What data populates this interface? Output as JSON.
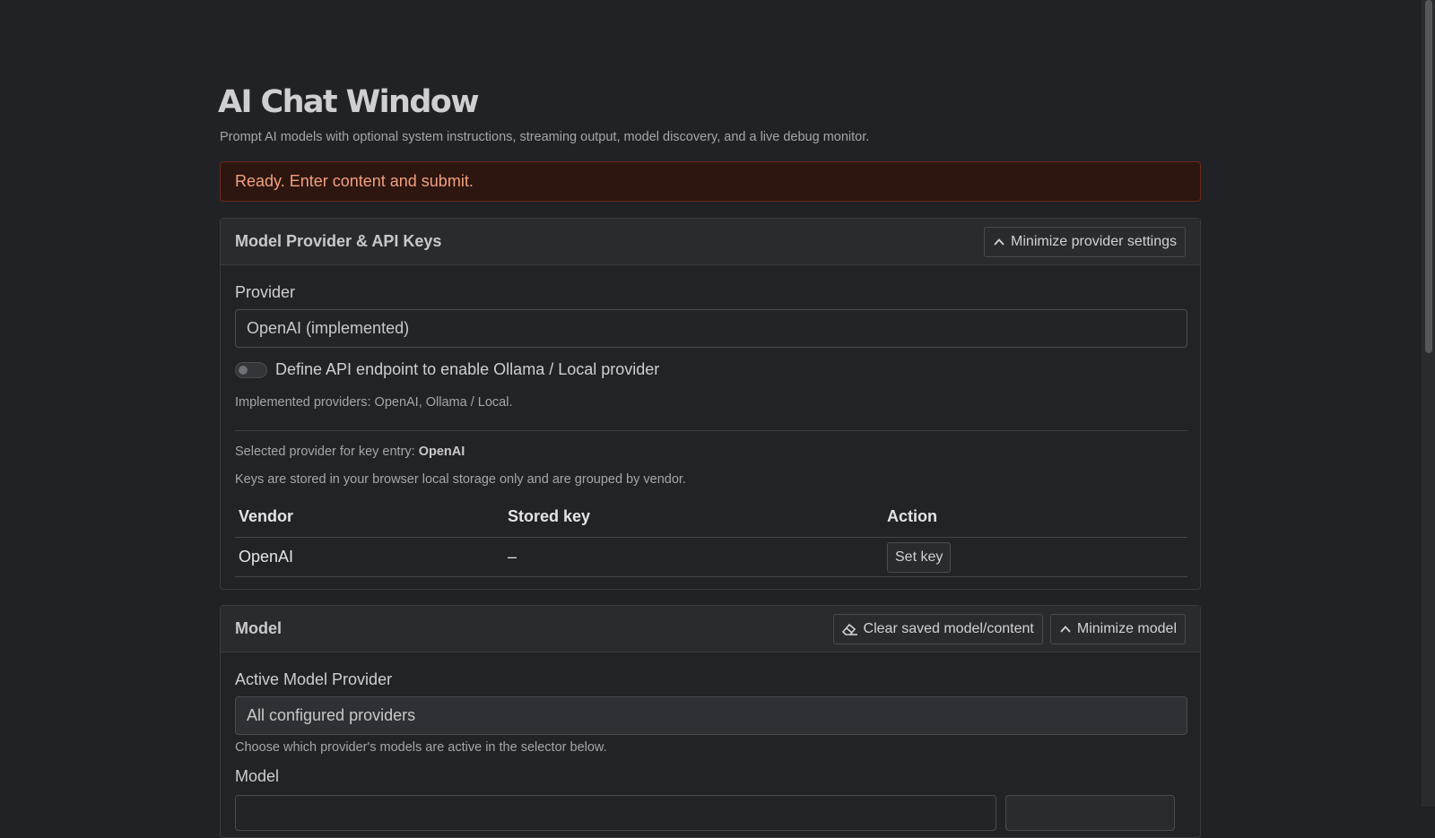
{
  "page": {
    "title": "AI Chat Window",
    "subtitle": "Prompt AI models with optional system instructions, streaming output, model discovery, and a live debug monitor.",
    "status": "Ready. Enter content and submit."
  },
  "provider_card": {
    "title": "Model Provider & API Keys",
    "minimize_label": "Minimize provider settings",
    "provider_label": "Provider",
    "provider_value": "OpenAI (implemented)",
    "toggle_label": "Define API endpoint to enable Ollama / Local provider",
    "implemented_note": "Implemented providers: OpenAI, Ollama / Local.",
    "selected_prefix": "Selected provider for key entry:",
    "selected_value": "OpenAI",
    "storage_note": "Keys are stored in your browser local storage only and are grouped by vendor.",
    "table": {
      "headers": [
        "Vendor",
        "Stored key",
        "Action"
      ],
      "rows": [
        {
          "vendor": "OpenAI",
          "stored_key": "–",
          "action": "Set key"
        }
      ]
    }
  },
  "model_card": {
    "title": "Model",
    "clear_label": "Clear saved model/content",
    "minimize_label": "Minimize model",
    "active_provider_label": "Active Model Provider",
    "active_provider_value": "All configured providers",
    "active_provider_note": "Choose which provider's models are active in the selector below.",
    "model_label": "Model"
  },
  "colors": {
    "background": "#212226",
    "status_bg": "#2d1610",
    "status_text": "#f2a07f"
  }
}
